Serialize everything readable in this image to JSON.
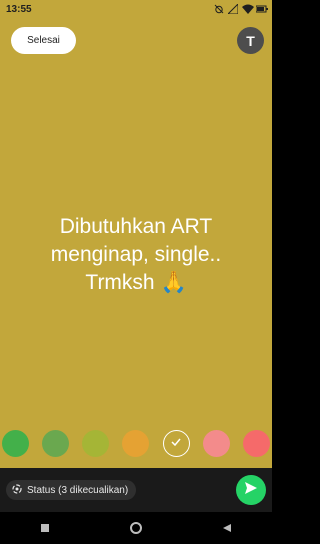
{
  "status_bar": {
    "time": "13:55",
    "icons": [
      "alarm-off-icon",
      "signal-icon",
      "wifi-icon",
      "battery-icon"
    ]
  },
  "canvas": {
    "background_color": "#c2a73b",
    "done_label": "Selesai",
    "avatar_letter": "T",
    "status_text": "Dibutuhkan ART menginap, single.. Trmksh 🙏"
  },
  "palette": {
    "colors": [
      "#43b04a",
      "#6aa84f",
      "#a5b536",
      "#e5a233",
      "#c2a73b",
      "#f38b8b",
      "#f56a6a"
    ],
    "selected_index": 4
  },
  "bottom_bar": {
    "audience_label": "Status (3 dikecualikan)",
    "send_color": "#25d366"
  },
  "nav": {
    "items": [
      "recent-apps-icon",
      "home-icon",
      "back-icon"
    ]
  }
}
